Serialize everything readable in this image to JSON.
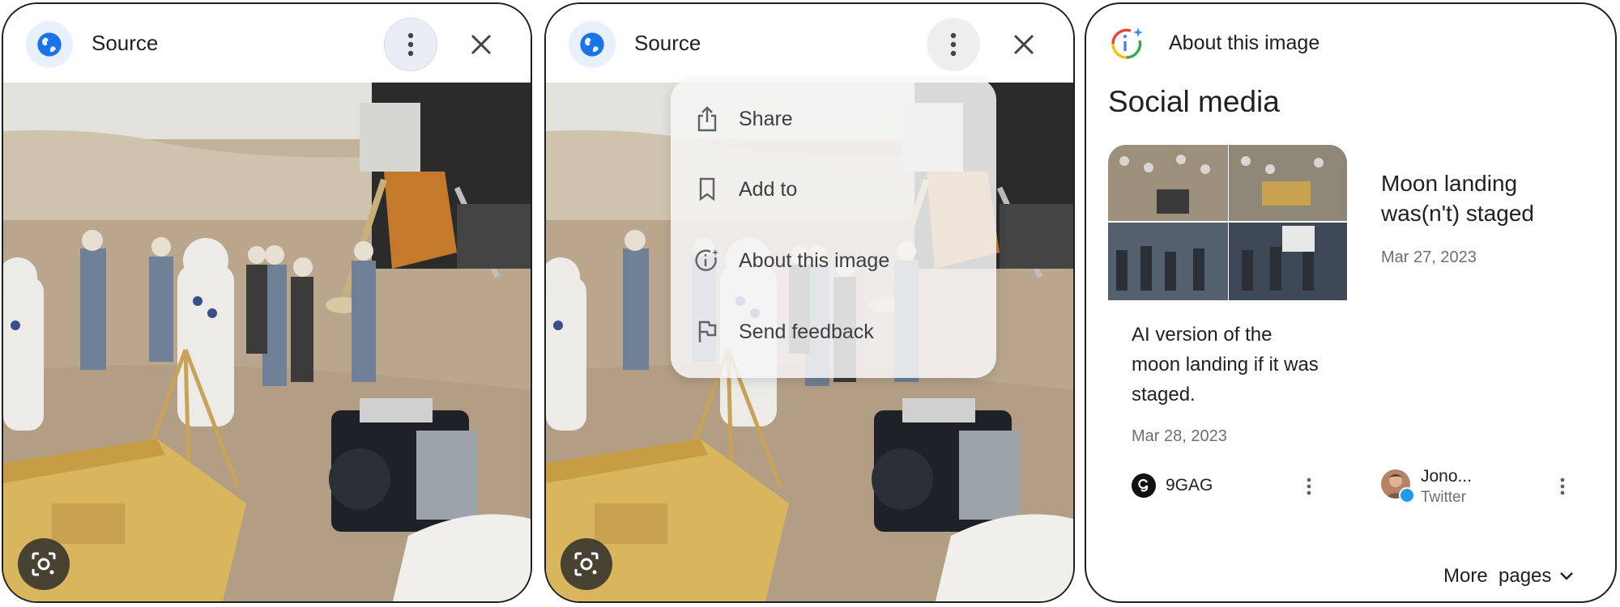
{
  "panels": [
    {
      "source_label": "Source",
      "icons": {
        "site": "globe-icon",
        "more": "more-vert-icon",
        "close": "close-icon",
        "lens": "google-lens-icon"
      }
    },
    {
      "source_label": "Source",
      "icons": {
        "site": "globe-icon",
        "more": "more-vert-icon",
        "close": "close-icon",
        "lens": "google-lens-icon"
      },
      "menu": [
        {
          "label": "Share",
          "icon": "share-icon"
        },
        {
          "label": "Add to",
          "icon": "bookmark-icon"
        },
        {
          "label": "About this image",
          "icon": "about-image-icon"
        },
        {
          "label": "Send feedback",
          "icon": "flag-icon"
        }
      ]
    }
  ],
  "about": {
    "header_title": "About this image",
    "section_title": "Social media",
    "cards": [
      {
        "title": "AI version of the moon landing if it was staged.",
        "date": "Mar 28, 2023",
        "source_name": "9GAG",
        "source_icon": "9gag-logo-icon"
      },
      {
        "title": "Moon landing was(n't) staged",
        "date": "Mar 27, 2023",
        "source_name": "Jono...",
        "source_sub": "Twitter",
        "source_icon": "avatar"
      }
    ],
    "more_pages": "More  pages"
  },
  "colors": {
    "accent_blue": "#1a73e8",
    "globe_bg": "#e8f0fe",
    "text_primary": "#202124",
    "text_secondary": "#6f6f6f",
    "twitter": "#1d9bf0"
  }
}
